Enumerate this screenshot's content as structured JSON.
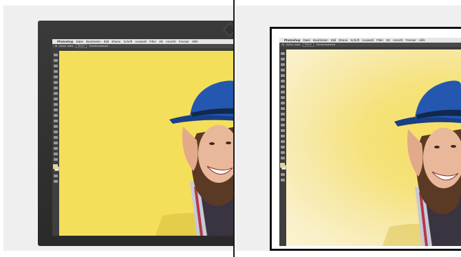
{
  "menubar": {
    "app_name": "Photoshop",
    "items": [
      "Datei",
      "Bearbeiten",
      "Bild",
      "Ebene",
      "Schrift",
      "Auswahl",
      "Filter",
      "3D",
      "Ansicht",
      "Fenster",
      "Hilfe"
    ]
  },
  "optionsbar": {
    "items": [
      "Autom. ausw.",
      "Ebene",
      "Transformationsst."
    ]
  },
  "colors": {
    "yellow_background": "#f4df5a",
    "hat_blue": "#1f4e9a",
    "photoshop_chrome": "#535353",
    "monitor_bezel": "#2b2b2b"
  },
  "icons": [
    "apple-icon",
    "move-tool-icon",
    "marquee-tool-icon",
    "lasso-tool-icon",
    "crop-tool-icon",
    "brush-tool-icon",
    "eraser-tool-icon",
    "type-tool-icon",
    "zoom-tool-icon",
    "color-swatches-icon"
  ]
}
